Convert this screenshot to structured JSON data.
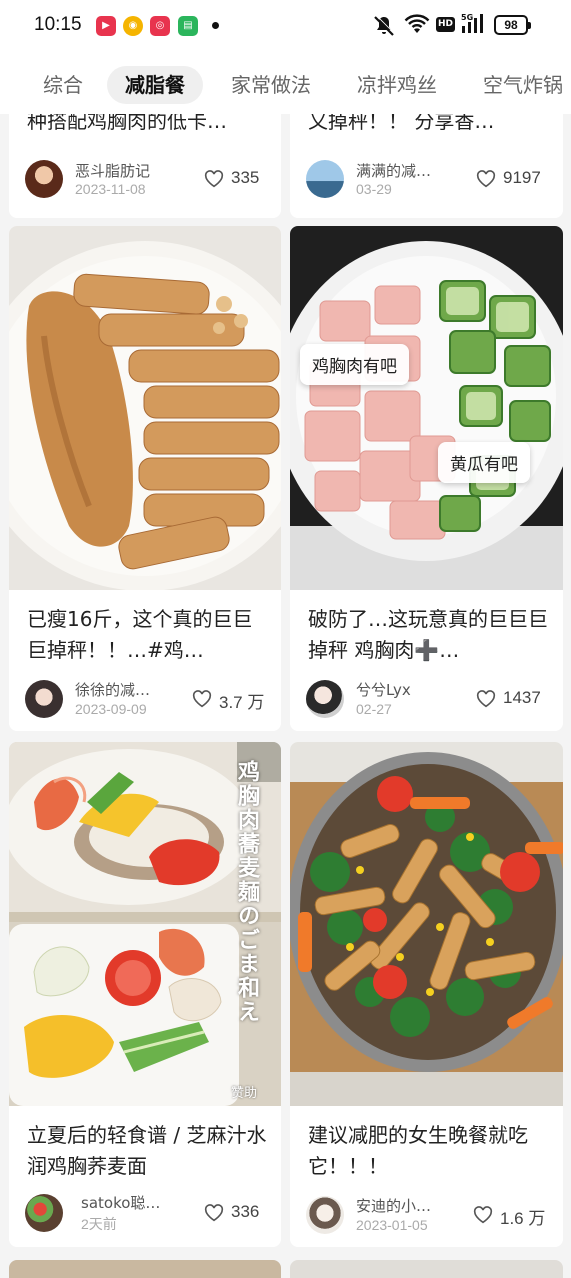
{
  "status_bar": {
    "time": "10:15",
    "hd": "HD",
    "battery": "98",
    "app_icons": [
      "video-app-icon",
      "weibo-icon",
      "netease-icon",
      "chat-icon"
    ]
  },
  "tabs": [
    {
      "label": "综合",
      "active": false
    },
    {
      "label": "减脂餐",
      "active": true
    },
    {
      "label": "家常做法",
      "active": false
    },
    {
      "label": "凉拌鸡丝",
      "active": false
    },
    {
      "label": "空气炸锅",
      "active": false
    }
  ],
  "cards": [
    {
      "title": "种搭配鸡胸肉的低卡…",
      "author": "恶斗脂肪记",
      "date": "2023-11-08",
      "likes": "335"
    },
    {
      "title": "又掉秤！！ 分享香…",
      "author": "满满的减…",
      "date": "03-29",
      "likes": "9197"
    },
    {
      "title": "已瘦16斤，这个真的巨巨巨掉秤！！…#鸡…",
      "author": "徐徐的减…",
      "date": "2023-09-09",
      "likes": "3.7 万"
    },
    {
      "title": "破防了…这玩意真的巨巨巨掉秤 鸡胸肉➕…",
      "author": "兮兮Lyx",
      "date": "02-27",
      "likes": "1437",
      "tags": [
        "鸡胸肉有吧",
        "黄瓜有吧"
      ]
    },
    {
      "title": "立夏后的轻食谱 / 芝麻汁水润鸡胸荞麦面",
      "author": "satoko聪…",
      "date": "2天前",
      "likes": "336",
      "vertical_text": "鸡胸肉蕎麦麺のごま和え",
      "ad_label": "赞助"
    },
    {
      "title": "建议减肥的女生晚餐就吃它！！！",
      "author": "安迪的小…",
      "date": "2023-01-05",
      "likes": "1.6 万"
    }
  ]
}
